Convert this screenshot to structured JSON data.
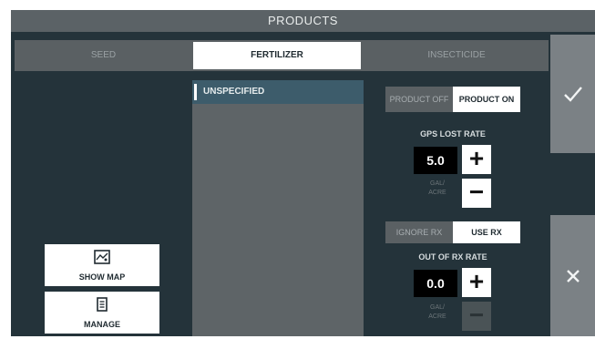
{
  "window": {
    "title": "PRODUCTS"
  },
  "tabs": [
    {
      "label": "SEED",
      "active": false
    },
    {
      "label": "FERTILIZER",
      "active": true
    },
    {
      "label": "INSECTICIDE",
      "active": false
    }
  ],
  "product_list": {
    "items": [
      "UNSPECIFIED"
    ]
  },
  "product_toggle": {
    "off_label": "PRODUCT OFF",
    "on_label": "PRODUCT ON",
    "selected": "PRODUCT ON"
  },
  "gps_lost_rate": {
    "label": "GPS LOST RATE",
    "value": "5.0",
    "sub_label_1": "GAL/",
    "sub_label_2": "ACRE"
  },
  "rx_toggle": {
    "ignore_label": "IGNORE RX",
    "use_label": "USE RX",
    "selected": "USE RX"
  },
  "out_of_rx_rate": {
    "label": "OUT OF RX RATE",
    "value": "0.0",
    "sub_label_1": "GAL/",
    "sub_label_2": "ACRE"
  },
  "actions": {
    "show_map_label": "SHOW MAP",
    "manage_label": "MANAGE"
  },
  "side_buttons": {
    "confirm_icon": "check-icon",
    "cancel_icon": "close-icon"
  },
  "colors": {
    "background": "#24333a",
    "titlebar": "#5b6266",
    "selected_item": "#3d5c6b",
    "side_button": "#7b8185"
  }
}
